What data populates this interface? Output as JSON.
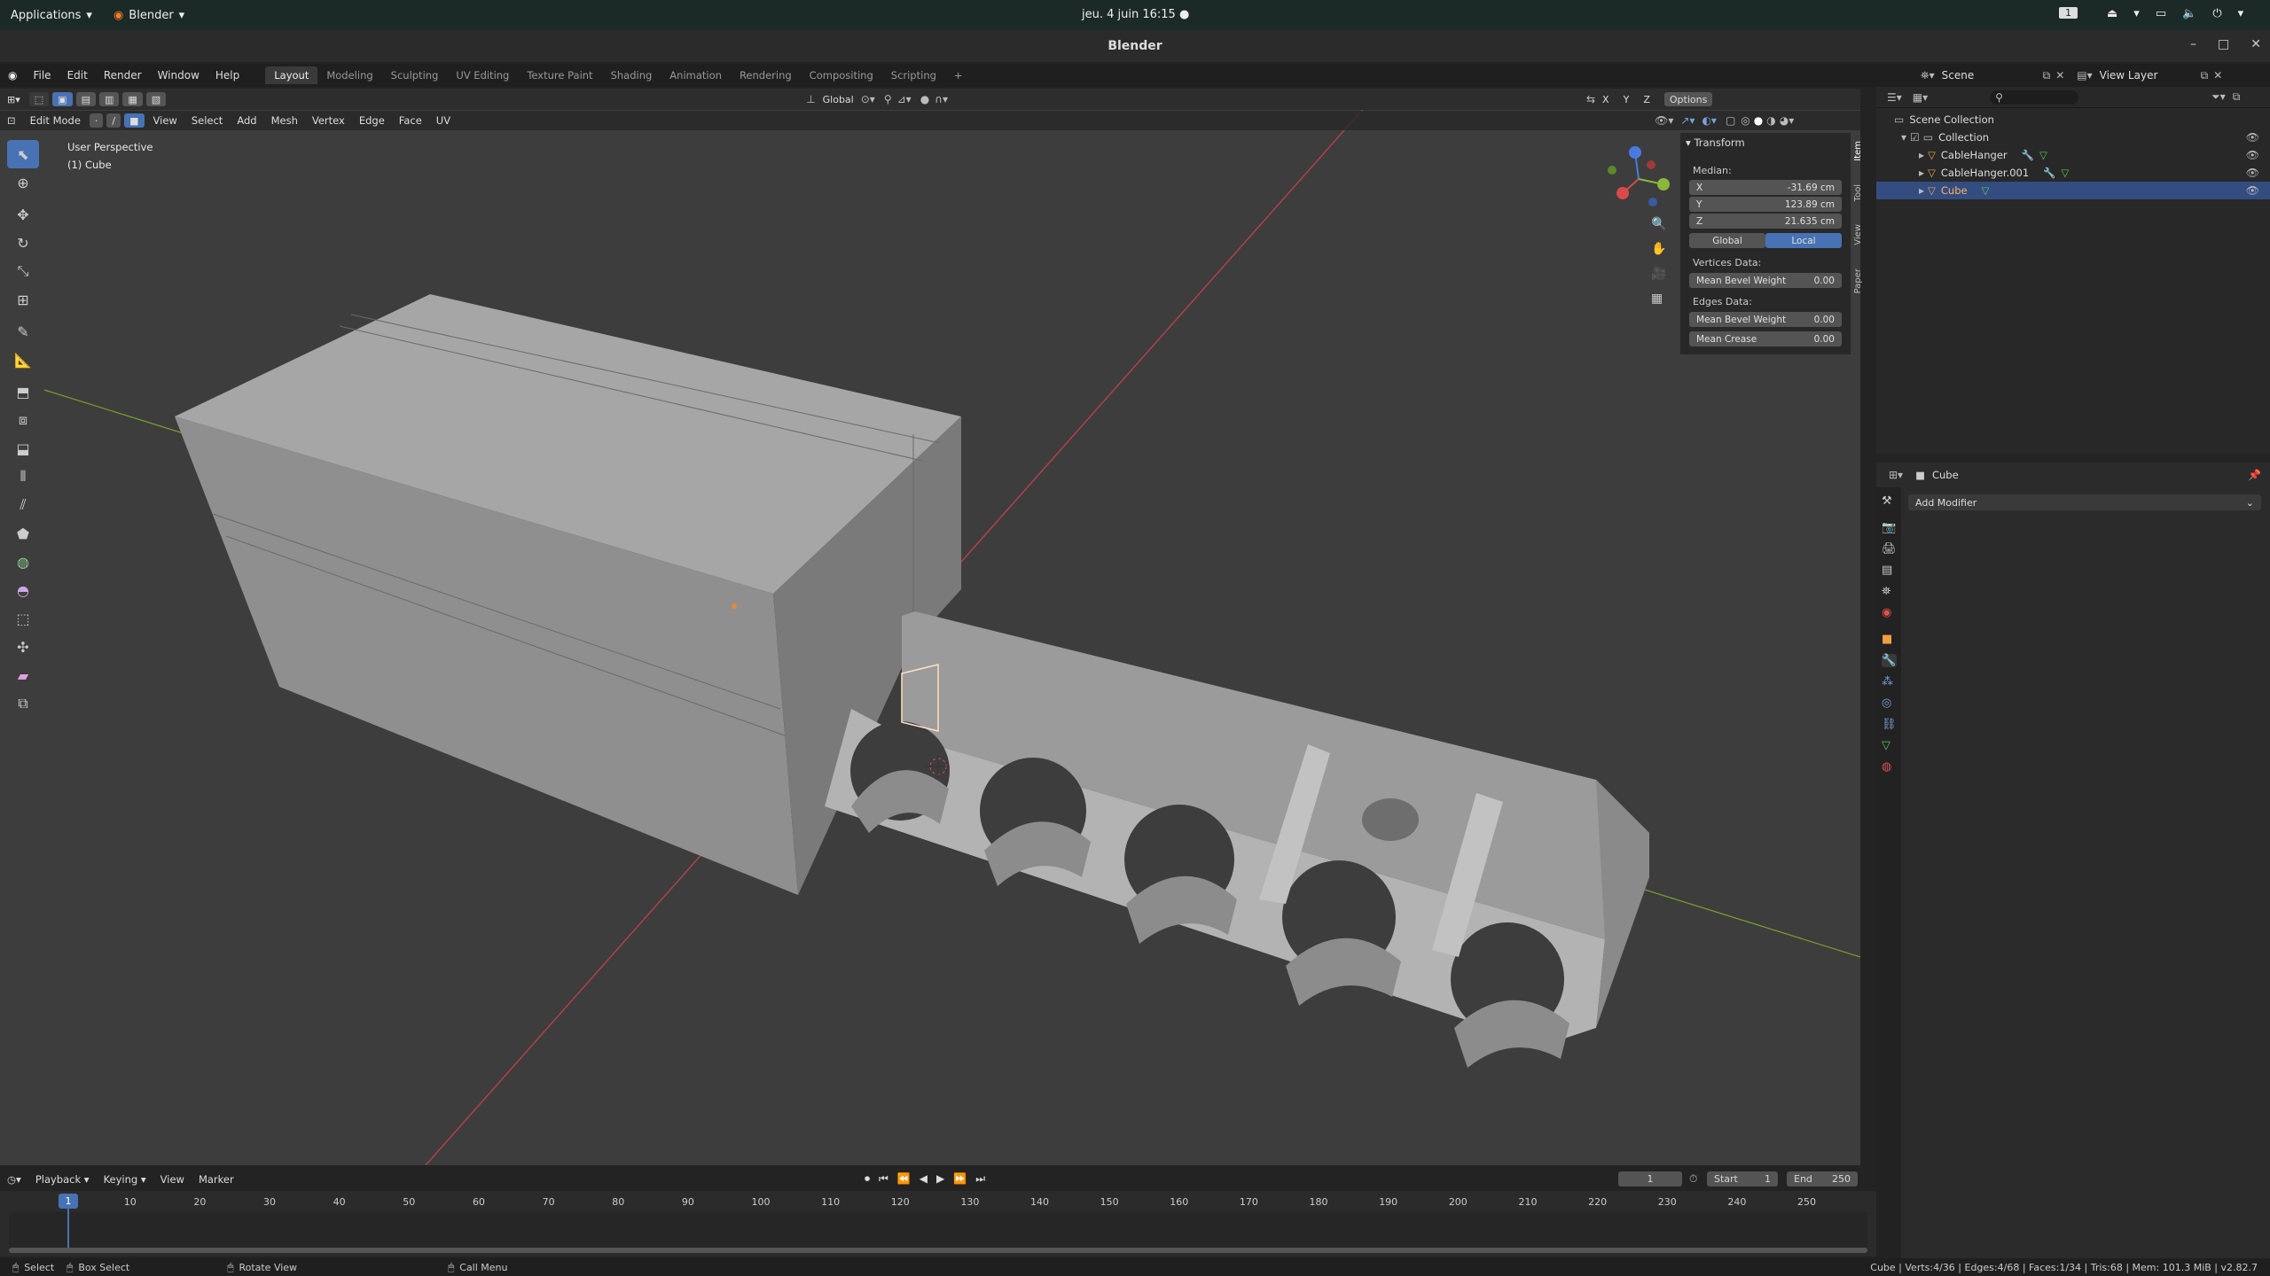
{
  "gnome": {
    "apps": "Applications",
    "blender_app": "Blender",
    "clock": "jeu. 4 juin  16:15 ●",
    "workspace": "1"
  },
  "title": "Blender",
  "menu": {
    "items": [
      "File",
      "Edit",
      "Render",
      "Window",
      "Help"
    ],
    "tabs": [
      "Layout",
      "Modeling",
      "Sculpting",
      "UV Editing",
      "Texture Paint",
      "Shading",
      "Animation",
      "Rendering",
      "Compositing",
      "Scripting"
    ],
    "add_tab": "+"
  },
  "viewport": {
    "mode": "Edit Mode",
    "menus": [
      "View",
      "Select",
      "Add",
      "Mesh",
      "Vertex",
      "Edge",
      "Face",
      "UV"
    ],
    "orientation": "Global",
    "options": "Options",
    "axes": [
      "X",
      "Y",
      "Z"
    ],
    "overlay_title": "User Perspective",
    "overlay_sub": "(1) Cube"
  },
  "npanel": {
    "section": "Transform",
    "median": "Median:",
    "x_label": "X",
    "x": "-31.69 cm",
    "y_label": "Y",
    "y": "123.89 cm",
    "z_label": "Z",
    "z": "21.635 cm",
    "global": "Global",
    "local": "Local",
    "vertices_data": "Vertices Data:",
    "vert_bevel": "Mean Bevel Weight",
    "vert_bevel_val": "0.00",
    "edges_data": "Edges Data:",
    "edge_bevel": "Mean Bevel Weight",
    "edge_bevel_val": "0.00",
    "crease": "Mean Crease",
    "crease_val": "0.00",
    "tabs": [
      "Item",
      "Tool",
      "View",
      "Paper"
    ]
  },
  "outliner": {
    "scene": "Scene",
    "view_layer": "View Layer",
    "scene_collection": "Scene Collection",
    "collection": "Collection",
    "objects": [
      "CableHanger",
      "CableHanger.001",
      "Cube"
    ]
  },
  "properties": {
    "object": "Cube",
    "add_modifier": "Add Modifier"
  },
  "timeline": {
    "menus": [
      "Playback",
      "Keying",
      "View",
      "Marker"
    ],
    "frame": "1",
    "start_label": "Start",
    "start": "1",
    "end_label": "End",
    "end": "250",
    "ticks": [
      "1",
      "10",
      "20",
      "30",
      "40",
      "50",
      "60",
      "70",
      "80",
      "90",
      "100",
      "110",
      "120",
      "130",
      "140",
      "150",
      "160",
      "170",
      "180",
      "190",
      "200",
      "210",
      "220",
      "230",
      "240",
      "250"
    ]
  },
  "status": {
    "select": "Select",
    "box_select": "Box Select",
    "rotate": "Rotate View",
    "call_menu": "Call Menu",
    "info": "Cube | Verts:4/36 | Edges:4/68 | Faces:1/34 | Tris:68 | Mem: 101.3 MiB | v2.82.7"
  }
}
